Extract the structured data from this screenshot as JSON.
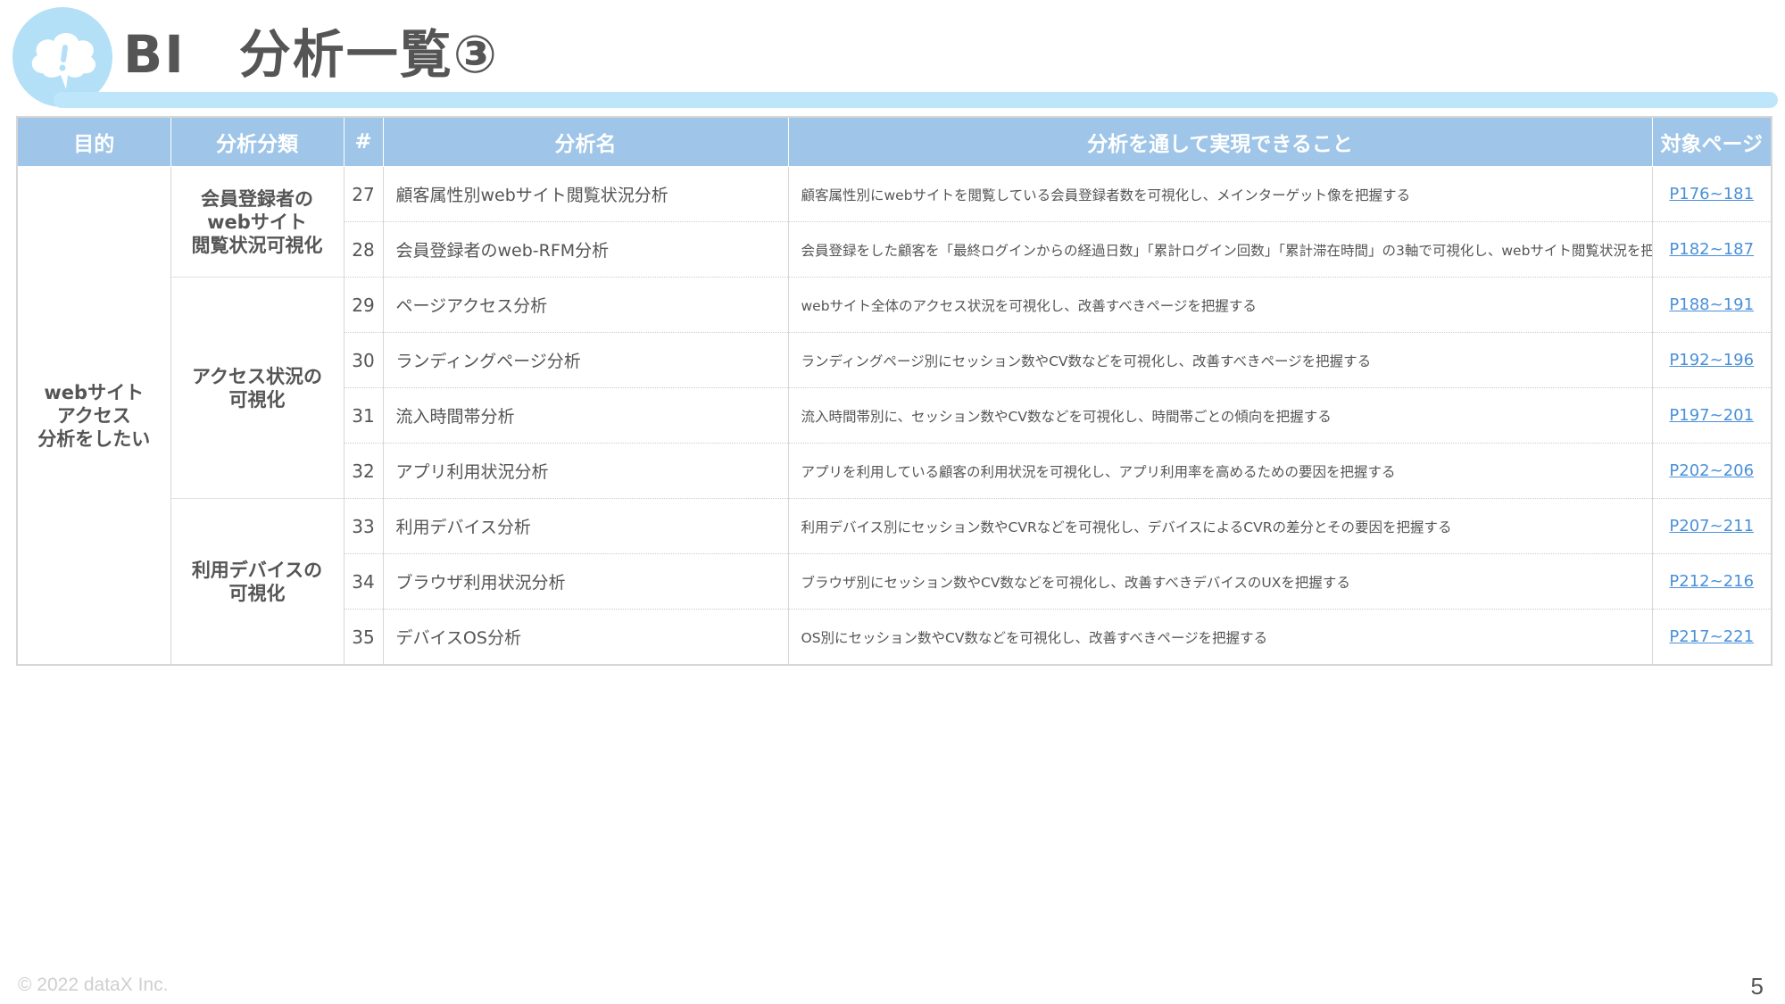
{
  "header": {
    "title": "BI　分析一覧③"
  },
  "table": {
    "columns": [
      "目的",
      "分析分類",
      "#",
      "分析名",
      "分析を通して実現できること",
      "対象ページ"
    ],
    "purpose_lines": [
      "webサイト",
      "アクセス",
      "分析をしたい"
    ],
    "groups": [
      {
        "category_lines": [
          "会員登録者の",
          "webサイト",
          "閲覧状況可視化"
        ],
        "rows": [
          {
            "num": "27",
            "name": "顧客属性別webサイト閲覧状況分析",
            "desc": "顧客属性別にwebサイトを閲覧している会員登録者数を可視化し、メインターゲット像を把握する",
            "page": "P176~181"
          },
          {
            "num": "28",
            "name": "会員登録者のweb-RFM分析",
            "desc": "会員登録をした顧客を「最終ログインからの経過日数」「累計ログイン回数」「累計滞在時間」の3軸で可視化し、webサイト閲覧状況を把握する",
            "page": "P182~187"
          }
        ]
      },
      {
        "category_lines": [
          "アクセス状況の",
          "可視化"
        ],
        "rows": [
          {
            "num": "29",
            "name": "ページアクセス分析",
            "desc": "webサイト全体のアクセス状況を可視化し、改善すべきページを把握する",
            "page": "P188~191"
          },
          {
            "num": "30",
            "name": "ランディングページ分析",
            "desc": "ランディングページ別にセッション数やCV数などを可視化し、改善すべきページを把握する",
            "page": "P192~196"
          },
          {
            "num": "31",
            "name": "流入時間帯分析",
            "desc": "流入時間帯別に、セッション数やCV数などを可視化し、時間帯ごとの傾向を把握する",
            "page": "P197~201"
          },
          {
            "num": "32",
            "name": "アプリ利用状況分析",
            "desc": "アプリを利用している顧客の利用状況を可視化し、アプリ利用率を高めるための要因を把握する",
            "page": "P202~206"
          }
        ]
      },
      {
        "category_lines": [
          "利用デバイスの",
          "可視化"
        ],
        "rows": [
          {
            "num": "33",
            "name": "利用デバイス分析",
            "desc": "利用デバイス別にセッション数やCVRなどを可視化し、デバイスによるCVRの差分とその要因を把握する",
            "page": "P207~211"
          },
          {
            "num": "34",
            "name": "ブラウザ利用状況分析",
            "desc": "ブラウザ別にセッション数やCV数などを可視化し、改善すべきデバイスのUXを把握する",
            "page": "P212~216"
          },
          {
            "num": "35",
            "name": "デバイスOS分析",
            "desc": "OS別にセッション数やCV数などを可視化し、改善すべきページを把握する",
            "page": "P217~221"
          }
        ]
      }
    ]
  },
  "footer": {
    "copyright": "© 2022 dataX Inc.",
    "page_number": "5"
  },
  "colors": {
    "header_bg": "#9fc5e8",
    "accent_bar": "#bde6fa",
    "logo_circle": "#b3e0f7",
    "link": "#4a90d9"
  },
  "icons": {
    "logo": "cloud-exclamation-icon"
  }
}
